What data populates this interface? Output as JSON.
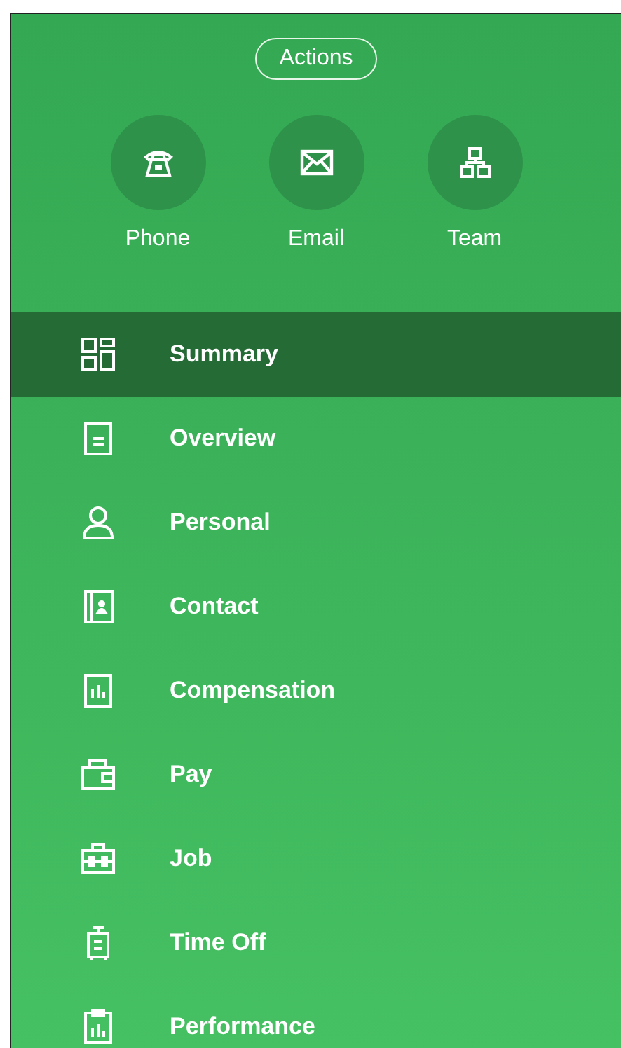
{
  "actions_button": "Actions",
  "quick_actions": [
    {
      "kind": "phone",
      "label": "Phone"
    },
    {
      "kind": "email",
      "label": "Email"
    },
    {
      "kind": "team",
      "label": "Team"
    }
  ],
  "menu": [
    {
      "kind": "summary",
      "label": "Summary",
      "selected": true
    },
    {
      "kind": "overview",
      "label": "Overview",
      "selected": false
    },
    {
      "kind": "personal",
      "label": "Personal",
      "selected": false
    },
    {
      "kind": "contact",
      "label": "Contact",
      "selected": false
    },
    {
      "kind": "compensation",
      "label": "Compensation",
      "selected": false
    },
    {
      "kind": "pay",
      "label": "Pay",
      "selected": false
    },
    {
      "kind": "job",
      "label": "Job",
      "selected": false
    },
    {
      "kind": "timeoff",
      "label": "Time Off",
      "selected": false
    },
    {
      "kind": "performance",
      "label": "Performance",
      "selected": false
    }
  ]
}
